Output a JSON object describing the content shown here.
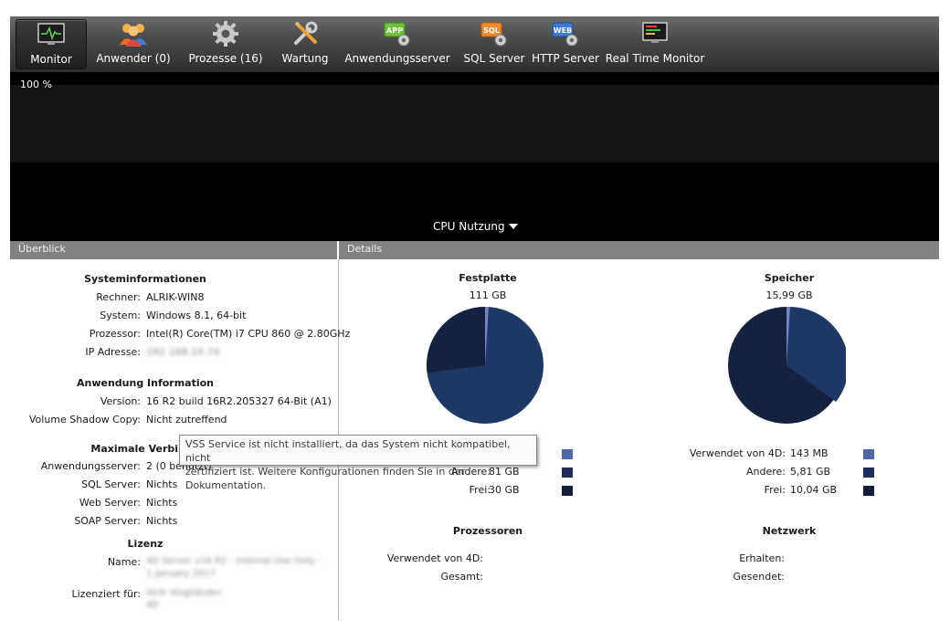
{
  "toolbar": {
    "items": [
      {
        "label": "Monitor",
        "icon": "monitor-icon"
      },
      {
        "label": "Anwender (0)",
        "icon": "users-icon"
      },
      {
        "label": "Prozesse (16)",
        "icon": "gear-icon"
      },
      {
        "label": "Wartung",
        "icon": "tools-icon"
      },
      {
        "label": "Anwendungsserver",
        "icon": "app-server-icon",
        "badge": "APP"
      },
      {
        "label": "SQL Server",
        "icon": "sql-server-icon",
        "badge": "SQL"
      },
      {
        "label": "HTTP Server",
        "icon": "web-server-icon",
        "badge": "WEB"
      },
      {
        "label": "Real Time Monitor",
        "icon": "realtime-monitor-icon"
      }
    ]
  },
  "graph": {
    "percent_label": "100 %",
    "selector_label": "CPU Nutzung"
  },
  "overview": {
    "header": "Überblick",
    "system": {
      "title": "Systeminformationen",
      "rows": [
        {
          "key": "Rechner:",
          "value": "ALRIK-WIN8"
        },
        {
          "key": "System:",
          "value": "Windows 8.1, 64-bit"
        },
        {
          "key": "Prozessor:",
          "value": "Intel(R) Core(TM) i7 CPU 860 @ 2.80GHz"
        },
        {
          "key": "IP Adresse:",
          "value": "192.168.10.74"
        }
      ]
    },
    "app": {
      "title": "Anwendung Information",
      "rows": [
        {
          "key": "Version:",
          "value": "16 R2 build 16R2.205327 64-Bit (A1)"
        },
        {
          "key": "Volume Shadow Copy:",
          "value": "Nicht zutreffend"
        }
      ]
    },
    "conn": {
      "title": "Maximale Verbindu",
      "rows": [
        {
          "key": "Anwendungsserver:",
          "value": "2 (0 benutzt)"
        },
        {
          "key": "SQL Server:",
          "value": "Nichts"
        },
        {
          "key": "Web Server:",
          "value": "Nichts"
        },
        {
          "key": "SOAP Server:",
          "value": "Nichts"
        }
      ]
    },
    "license": {
      "title": "Lizenz",
      "name_key": "Name:",
      "name_value_1": "4D Server v16 R2 - Internal Use Only - ",
      "name_value_2": "1 January 2017",
      "for_key": "Lizenziert für:",
      "for_value_1": "Alrik Voigtländer",
      "for_value_2": "4D"
    }
  },
  "details": {
    "header": "Details",
    "disk": {
      "title": "Festplatte",
      "total": "111 GB",
      "rows": [
        {
          "key": "Andere:",
          "value": "81 GB",
          "color": "#1f2d5c"
        },
        {
          "key": "Frei:",
          "value": "30 GB",
          "color": "#141d3a"
        }
      ],
      "used_color": "#4d67a8"
    },
    "memory": {
      "title": "Speicher",
      "total": "15,99 GB",
      "rows": [
        {
          "key": "Verwendet von 4D:",
          "value": "143 MB",
          "color": "#4d67a8"
        },
        {
          "key": "Andere:",
          "value": "5,81 GB",
          "color": "#1f2d5c"
        },
        {
          "key": "Frei:",
          "value": "10,04 GB",
          "color": "#141d3a"
        }
      ]
    },
    "processors": {
      "title": "Prozessoren",
      "used_key": "Verwendet von 4D:",
      "total_key": "Gesamt:"
    },
    "network": {
      "title": "Netzwerk",
      "received_key": "Erhalten:",
      "sent_key": "Gesendet:"
    }
  },
  "tooltip": {
    "line1": "VSS Service ist nicht installiert, da das System nicht kompatibel, nicht",
    "line2": "zertifiziert ist. Weitere Konfigurationen finden Sie in der Dokumentation."
  },
  "colors": {
    "used": "#4d67a8",
    "other": "#1f2d5c",
    "free": "#141d3a"
  }
}
